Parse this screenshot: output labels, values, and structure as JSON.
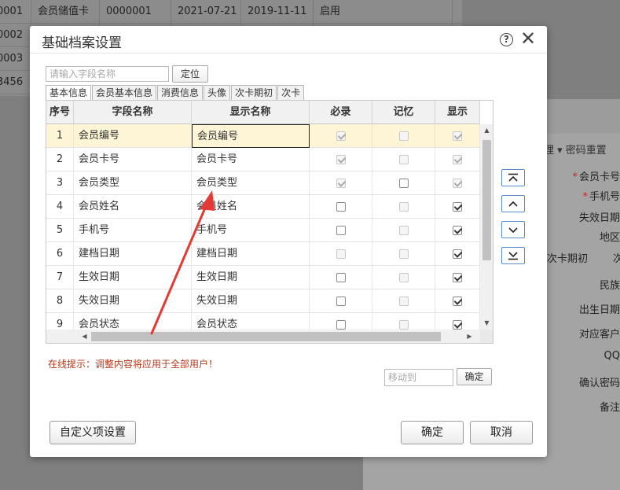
{
  "background": {
    "rows": [
      [
        "0001",
        "会员储值卡",
        "0000001",
        "2021-07-21",
        "2019-11-11",
        "启用"
      ],
      [
        "0002",
        "",
        "",
        "",
        "",
        ""
      ],
      [
        "0003",
        "",
        "",
        "",
        "",
        ""
      ],
      [
        "3456",
        "",
        "",
        "",
        "",
        ""
      ]
    ],
    "tabs_text": "理 ▾  密码重置",
    "side_tabs": [
      "次卡期初",
      "次"
    ],
    "form_labels": [
      {
        "req": "*",
        "text": "会员卡号"
      },
      {
        "req": "*",
        "text": "手机号"
      },
      {
        "req": "",
        "text": "失效日期"
      },
      {
        "req": "",
        "text": "地区"
      },
      {
        "req": "",
        "text": ""
      },
      {
        "req": "",
        "text": "民族"
      },
      {
        "req": "",
        "text": "出生日期"
      },
      {
        "req": "",
        "text": "对应客户"
      },
      {
        "req": "",
        "text": "QQ"
      },
      {
        "req": "",
        "text": "确认密码"
      },
      {
        "req": "",
        "text": "备注"
      }
    ]
  },
  "dialog": {
    "title": "基础档案设置",
    "help_icon": "help-circle-icon",
    "close_icon": "close-icon",
    "search_placeholder": "请输入字段名称",
    "locate_label": "定位",
    "tabs": [
      {
        "label": "基本信息",
        "active": true
      },
      {
        "label": "会员基本信息",
        "active": false
      },
      {
        "label": "消费信息",
        "active": false
      },
      {
        "label": "头像",
        "active": false
      },
      {
        "label": "次卡期初",
        "active": false
      },
      {
        "label": "次卡",
        "active": false
      }
    ],
    "grid": {
      "headers": [
        "序号",
        "字段名称",
        "显示名称",
        "必录",
        "记忆",
        "显示"
      ],
      "rows": [
        {
          "no": "1",
          "field": "会员编号",
          "display": "会员编号",
          "required": true,
          "required_disabled": true,
          "memory": false,
          "memory_disabled": true,
          "show": true,
          "show_disabled": true,
          "selected": true
        },
        {
          "no": "2",
          "field": "会员卡号",
          "display": "会员卡号",
          "required": true,
          "required_disabled": true,
          "memory": false,
          "memory_disabled": true,
          "show": true,
          "show_disabled": true,
          "selected": false
        },
        {
          "no": "3",
          "field": "会员类型",
          "display": "会员类型",
          "required": true,
          "required_disabled": true,
          "memory": false,
          "memory_disabled": false,
          "show": true,
          "show_disabled": true,
          "selected": false
        },
        {
          "no": "4",
          "field": "会员姓名",
          "display": "会员姓名",
          "required": false,
          "required_disabled": false,
          "memory": false,
          "memory_disabled": true,
          "show": true,
          "show_disabled": false,
          "selected": false
        },
        {
          "no": "5",
          "field": "手机号",
          "display": "手机号",
          "required": false,
          "required_disabled": false,
          "memory": false,
          "memory_disabled": true,
          "show": true,
          "show_disabled": false,
          "selected": false
        },
        {
          "no": "6",
          "field": "建档日期",
          "display": "建档日期",
          "required": false,
          "required_disabled": true,
          "memory": false,
          "memory_disabled": true,
          "show": true,
          "show_disabled": false,
          "selected": false
        },
        {
          "no": "7",
          "field": "生效日期",
          "display": "生效日期",
          "required": false,
          "required_disabled": false,
          "memory": false,
          "memory_disabled": true,
          "show": true,
          "show_disabled": false,
          "selected": false
        },
        {
          "no": "8",
          "field": "失效日期",
          "display": "失效日期",
          "required": false,
          "required_disabled": false,
          "memory": false,
          "memory_disabled": true,
          "show": true,
          "show_disabled": false,
          "selected": false
        },
        {
          "no": "9",
          "field": "会员状态",
          "display": "会员状态",
          "required": false,
          "required_disabled": false,
          "memory": false,
          "memory_disabled": true,
          "show": true,
          "show_disabled": false,
          "selected": false
        }
      ]
    },
    "move_buttons": [
      {
        "name": "move-top-button",
        "icon": "arrow-to-top-icon"
      },
      {
        "name": "move-up-button",
        "icon": "chevron-up-icon"
      },
      {
        "name": "move-down-button",
        "icon": "chevron-down-icon"
      },
      {
        "name": "move-bottom-button",
        "icon": "arrow-to-bottom-icon"
      }
    ],
    "hint": "在线提示：调整内容将应用于全部用户！",
    "moveto_placeholder": "移动到",
    "moveto_ok": "确定",
    "custom_button": "自定义项设置",
    "ok_button": "确定",
    "cancel_button": "取消",
    "annotation_color": "#e53935"
  }
}
